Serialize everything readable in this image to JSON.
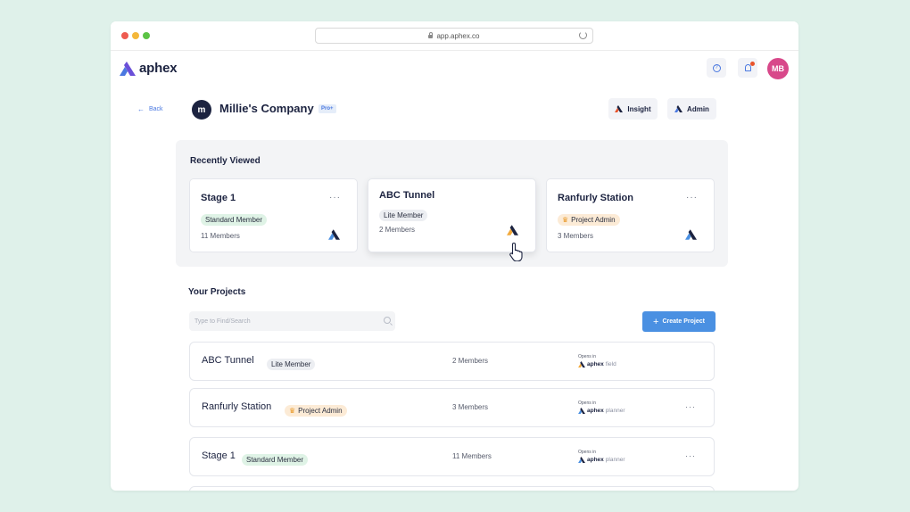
{
  "browser": {
    "url": "app.aphex.co"
  },
  "app": {
    "brand": "aphex"
  },
  "topbar": {
    "help_icon": "question-circle-icon",
    "bell_icon": "bell-icon",
    "avatar_initials": "MB",
    "avatar_color": "#d8488a",
    "notification_color": "#e8532b"
  },
  "header": {
    "back_label": "Back",
    "company_initial": "m",
    "company_name": "Millie's Company",
    "plan_badge": "Pro+",
    "insight_label": "Insight",
    "admin_label": "Admin"
  },
  "recent": {
    "title": "Recently Viewed",
    "items": [
      {
        "name": "Stage 1",
        "role": "Standard Member",
        "members": "11 Members"
      },
      {
        "name": "ABC Tunnel",
        "role": "Lite Member",
        "members": "2 Members"
      },
      {
        "name": "Ranfurly Station",
        "role": "Project Admin",
        "members": "3 Members"
      }
    ]
  },
  "projects": {
    "title": "Your Projects",
    "search_placeholder": "Type to Find/Search",
    "create_label": "Create Project",
    "opens_in_label": "Opens in",
    "rows": [
      {
        "name": "ABC Tunnel",
        "role": "Lite Member",
        "members": "2 Members",
        "brand": "aphex",
        "module": "field"
      },
      {
        "name": "Ranfurly Station",
        "role": "Project Admin",
        "members": "3 Members",
        "brand": "aphex",
        "module": "planner"
      },
      {
        "name": "Stage 1",
        "role": "Standard Member",
        "members": "11 Members",
        "brand": "aphex",
        "module": "planner"
      }
    ]
  },
  "colors": {
    "accent": "#4a90e2",
    "brand_dark": "#1c2340",
    "background": "#dff1ea"
  }
}
